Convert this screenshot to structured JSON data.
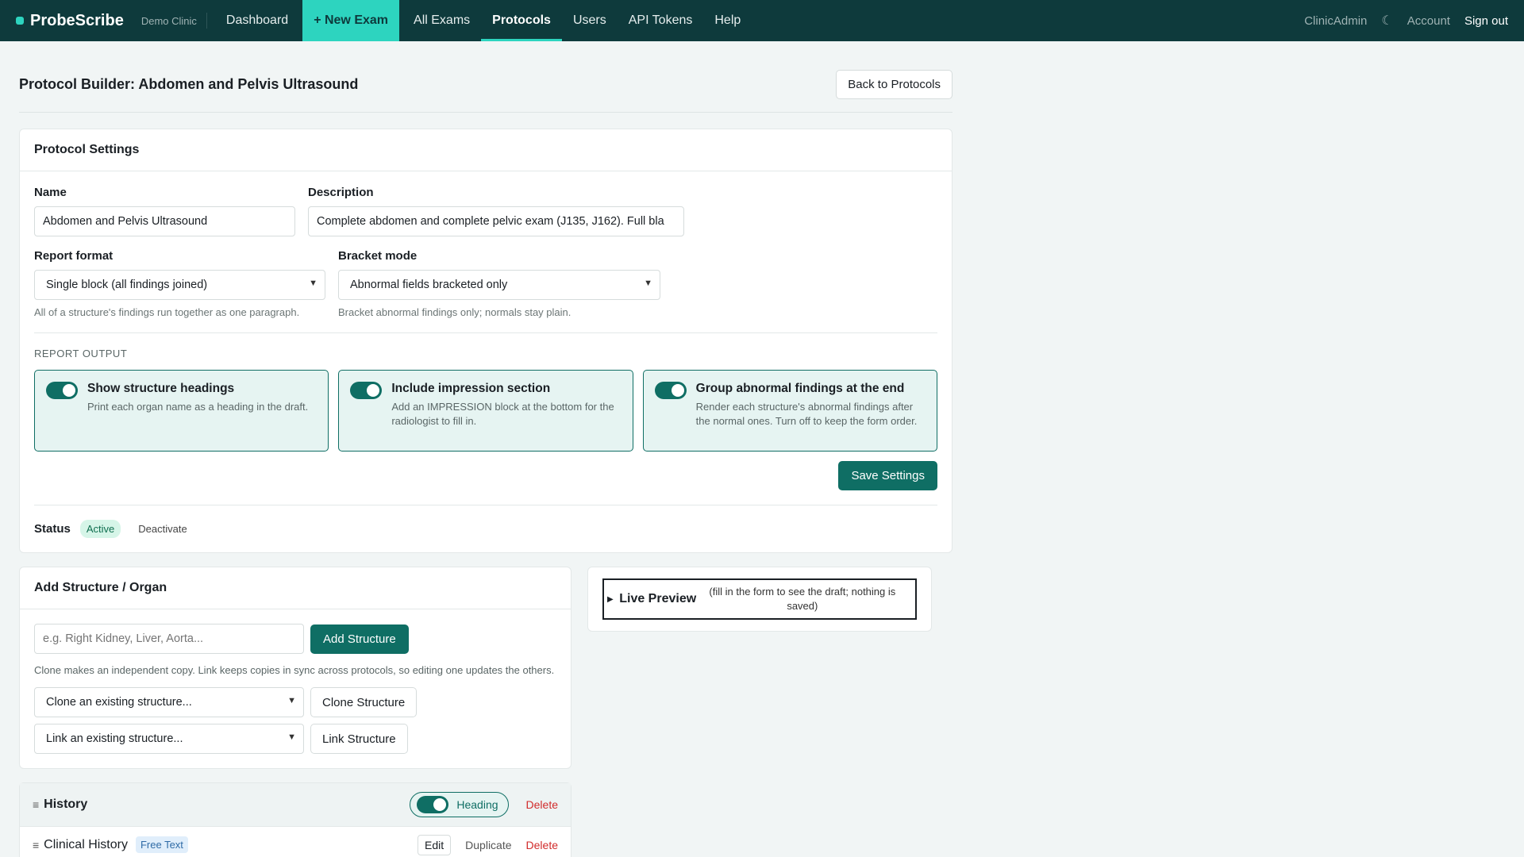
{
  "nav": {
    "brand": "ProbeScribe",
    "clinic": "Demo Clinic",
    "items": [
      "Dashboard",
      "+ New Exam",
      "All Exams",
      "Protocols",
      "Users",
      "API Tokens",
      "Help"
    ],
    "user": "ClinicAdmin",
    "theme_icon": "moon-icon",
    "account": "Account",
    "signout": "Sign out",
    "accent": "#2dd4bf",
    "bg": "#0e3a3c"
  },
  "page": {
    "title": "Protocol Builder: Abdomen and Pelvis Ultrasound",
    "back_button": "Back to Protocols"
  },
  "settings": {
    "heading": "Protocol Settings",
    "name_label": "Name",
    "name_value": "Abdomen and Pelvis Ultrasound",
    "description_label": "Description",
    "description_value": "Complete abdomen and complete pelvic exam (J135, J162). Full bla",
    "report_format_label": "Report format",
    "report_format_value": "Single block (all findings joined)",
    "report_format_hint": "All of a structure's findings run together as one paragraph.",
    "bracket_mode_label": "Bracket mode",
    "bracket_mode_value": "Abnormal fields bracketed only",
    "bracket_mode_hint": "Bracket abnormal findings only; normals stay plain.",
    "report_output_caption": "REPORT OUTPUT",
    "toggles": [
      {
        "title": "Show structure headings",
        "desc": "Print each organ name as a heading in the draft.",
        "on": true
      },
      {
        "title": "Include impression section",
        "desc": "Add an IMPRESSION block at the bottom for the radiologist to fill in.",
        "on": true
      },
      {
        "title": "Group abnormal findings at the end",
        "desc": "Render each structure's abnormal findings after the normal ones. Turn off to keep the form order.",
        "on": true
      }
    ],
    "save_button": "Save Settings",
    "status_label": "Status",
    "status_value": "Active",
    "deactivate": "Deactivate"
  },
  "add_structure": {
    "heading": "Add Structure / Organ",
    "placeholder": "e.g. Right Kidney, Liver, Aorta...",
    "add_button": "Add Structure",
    "help": "Clone makes an independent copy. Link keeps copies in sync across protocols, so editing one updates the others.",
    "clone_select": "Clone an existing structure...",
    "clone_button": "Clone Structure",
    "link_select": "Link an existing structure...",
    "link_button": "Link Structure"
  },
  "preview": {
    "title": "Live Preview",
    "note": "(fill in the form to see the draft; nothing is saved)"
  },
  "history": {
    "title": "History",
    "heading_toggle": "Heading",
    "delete": "Delete",
    "rows": [
      {
        "name": "Clinical History",
        "badge": "Free Text",
        "edit": "Edit",
        "duplicate": "Duplicate",
        "delete": "Delete"
      }
    ]
  }
}
